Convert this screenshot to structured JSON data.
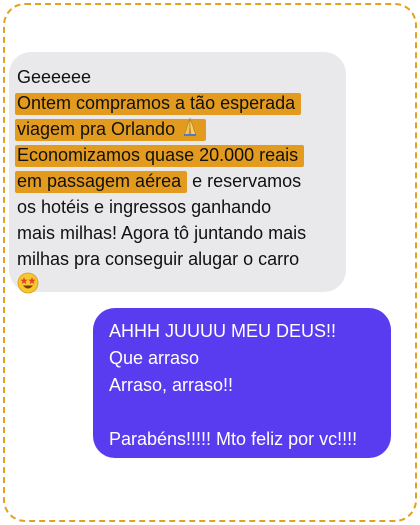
{
  "colors": {
    "frame_border": "#e3a11f",
    "received_bubble": "#e9e9eb",
    "sent_bubble": "#5a3cf0",
    "highlight": "#e39b1f"
  },
  "received_message": {
    "lines": [
      "Geeeeee",
      "Ontem compramos a tão esperada",
      "viagem pra Orlando",
      "Economizamos quase 20.000 reais",
      "em passagem aérea",
      " e reservamos",
      "os hotéis e ingressos ganhando",
      "mais milhas! Agora tô juntando mais",
      "milhas pra conseguir alugar o carro"
    ],
    "emojis": [
      "pray-emoji",
      "star-struck-emoji"
    ]
  },
  "sent_message": {
    "lines": [
      "AHHH JUUUU MEU DEUS!!",
      "Que arraso",
      "Arraso, arraso!!",
      "",
      "Parabéns!!!!! Mto feliz por vc!!!!"
    ]
  }
}
